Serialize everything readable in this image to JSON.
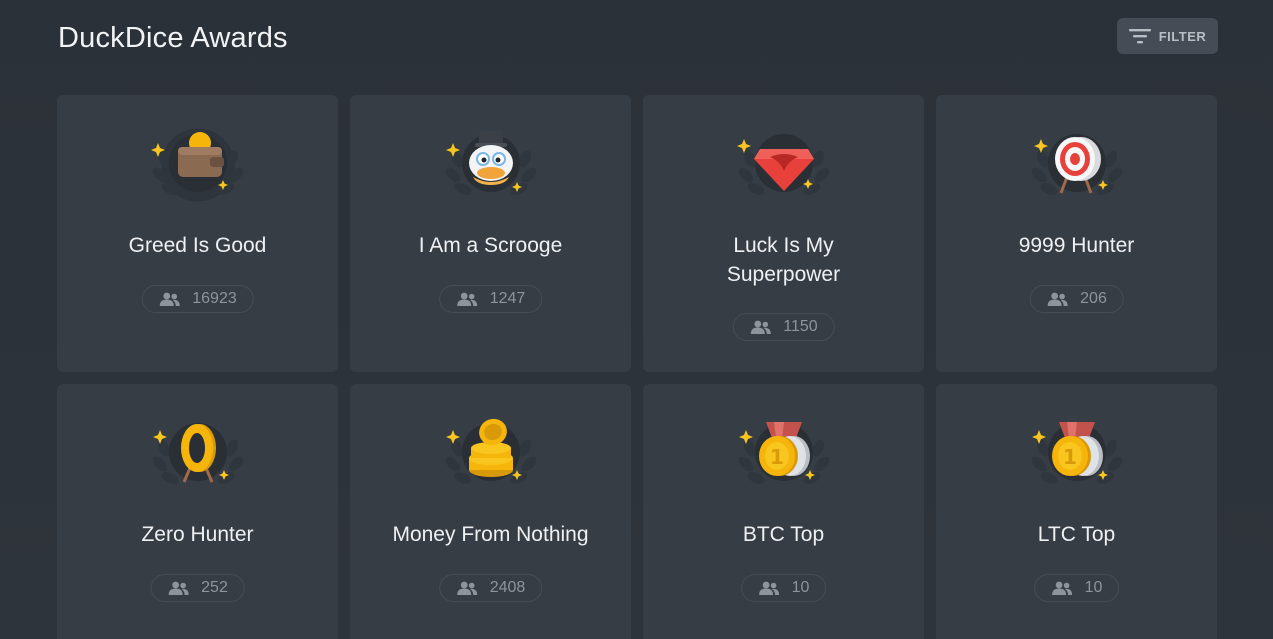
{
  "header": {
    "title": "DuckDice Awards",
    "filter_label": "FILTER",
    "filter_icon": "filter-icon"
  },
  "colors": {
    "background": "#2c3239",
    "card": "#373d45",
    "gold": "#f5b50a",
    "accent_red": "#e8403a"
  },
  "awards": [
    {
      "title": "Greed Is Good",
      "count": "16923",
      "icon": "wallet-coin-icon"
    },
    {
      "title": "I Am a Scrooge",
      "count": "1247",
      "icon": "scrooge-duck-icon"
    },
    {
      "title": "Luck Is My Superpower",
      "count": "1150",
      "icon": "superhero-emblem-icon"
    },
    {
      "title": "9999 Hunter",
      "count": "206",
      "icon": "target-icon"
    },
    {
      "title": "Zero Hunter",
      "count": "252",
      "icon": "zero-target-icon"
    },
    {
      "title": "Money From Nothing",
      "count": "2408",
      "icon": "coin-stack-icon"
    },
    {
      "title": "BTC Top",
      "count": "10",
      "icon": "gold-medal-icon"
    },
    {
      "title": "LTC Top",
      "count": "10",
      "icon": "gold-medal-icon"
    }
  ]
}
